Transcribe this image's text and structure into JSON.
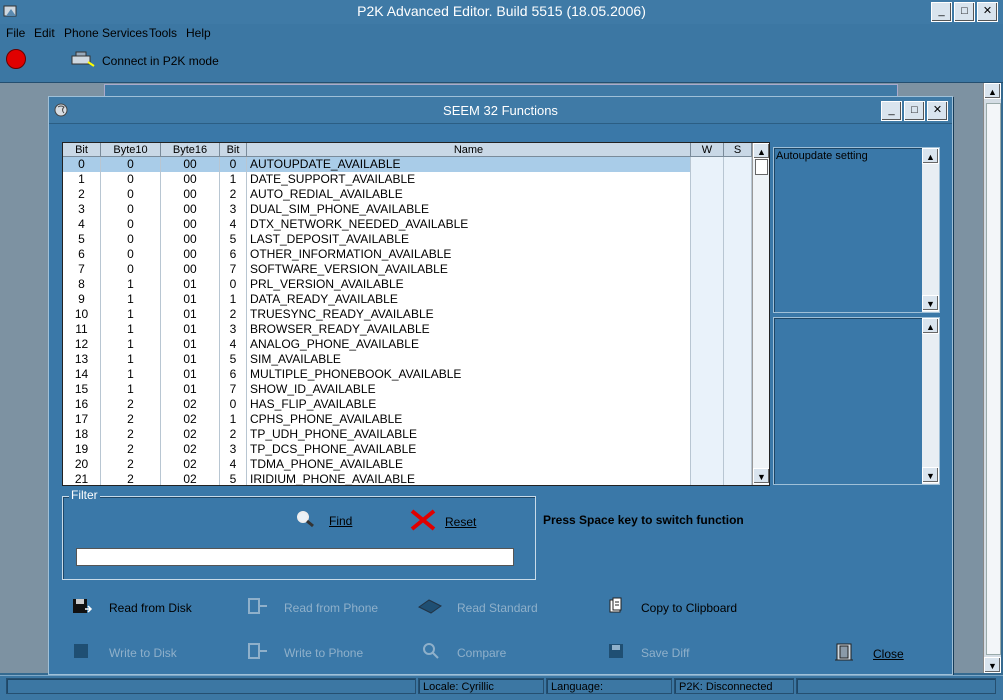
{
  "app": {
    "title": "P2K Advanced Editor. Build 5515 (18.05.2006)"
  },
  "menu": [
    "File",
    "Edit",
    "Phone Services",
    "Tools",
    "Help"
  ],
  "toolbar": {
    "connect_label": "Connect in P2K mode",
    "status_color": "#e00000"
  },
  "dialog": {
    "title": "SEEM 32 Functions"
  },
  "table": {
    "columns": [
      "Bit",
      "Byte10",
      "Byte16",
      "Bit",
      "Name",
      "W",
      "S"
    ],
    "rows": [
      [
        "0",
        "0",
        "00",
        "0",
        "AUTOUPDATE_AVAILABLE"
      ],
      [
        "1",
        "0",
        "00",
        "1",
        "DATE_SUPPORT_AVAILABLE"
      ],
      [
        "2",
        "0",
        "00",
        "2",
        "AUTO_REDIAL_AVAILABLE"
      ],
      [
        "3",
        "0",
        "00",
        "3",
        "DUAL_SIM_PHONE_AVAILABLE"
      ],
      [
        "4",
        "0",
        "00",
        "4",
        "DTX_NETWORK_NEEDED_AVAILABLE"
      ],
      [
        "5",
        "0",
        "00",
        "5",
        "LAST_DEPOSIT_AVAILABLE"
      ],
      [
        "6",
        "0",
        "00",
        "6",
        "OTHER_INFORMATION_AVAILABLE"
      ],
      [
        "7",
        "0",
        "00",
        "7",
        "SOFTWARE_VERSION_AVAILABLE"
      ],
      [
        "8",
        "1",
        "01",
        "0",
        "PRL_VERSION_AVAILABLE"
      ],
      [
        "9",
        "1",
        "01",
        "1",
        "DATA_READY_AVAILABLE"
      ],
      [
        "10",
        "1",
        "01",
        "2",
        "TRUESYNC_READY_AVAILABLE"
      ],
      [
        "11",
        "1",
        "01",
        "3",
        "BROWSER_READY_AVAILABLE"
      ],
      [
        "12",
        "1",
        "01",
        "4",
        "ANALOG_PHONE_AVAILABLE"
      ],
      [
        "13",
        "1",
        "01",
        "5",
        "SIM_AVAILABLE"
      ],
      [
        "14",
        "1",
        "01",
        "6",
        "MULTIPLE_PHONEBOOK_AVAILABLE"
      ],
      [
        "15",
        "1",
        "01",
        "7",
        "SHOW_ID_AVAILABLE"
      ],
      [
        "16",
        "2",
        "02",
        "0",
        "HAS_FLIP_AVAILABLE"
      ],
      [
        "17",
        "2",
        "02",
        "1",
        "CPHS_PHONE_AVAILABLE"
      ],
      [
        "18",
        "2",
        "02",
        "2",
        "TP_UDH_PHONE_AVAILABLE"
      ],
      [
        "19",
        "2",
        "02",
        "3",
        "TP_DCS_PHONE_AVAILABLE"
      ],
      [
        "20",
        "2",
        "02",
        "4",
        "TDMA_PHONE_AVAILABLE"
      ],
      [
        "21",
        "2",
        "02",
        "5",
        "IRIDIUM_PHONE_AVAILABLE"
      ]
    ],
    "selected_row": 0
  },
  "description": {
    "text": "Autoupdate setting"
  },
  "filter": {
    "legend": "Filter",
    "find_label": "Find",
    "reset_label": "Reset",
    "input_value": ""
  },
  "hint": "Press Space key to switch function",
  "buttons": {
    "read_disk": "Read from Disk",
    "read_phone": "Read from Phone",
    "read_standard": "Read Standard",
    "copy_clipboard": "Copy to Clipboard",
    "write_disk": "Write to Disk",
    "write_phone": "Write to Phone",
    "compare": "Compare",
    "save_diff": "Save Diff",
    "close": "Close"
  },
  "status": {
    "locale": "Locale: Cyrillic",
    "language": "Language:",
    "p2k": "P2K: Disconnected"
  },
  "colors": {
    "window_bg": "#3a78a8",
    "selected_row": "#a9cce8",
    "reset_icon": "#e00000"
  }
}
